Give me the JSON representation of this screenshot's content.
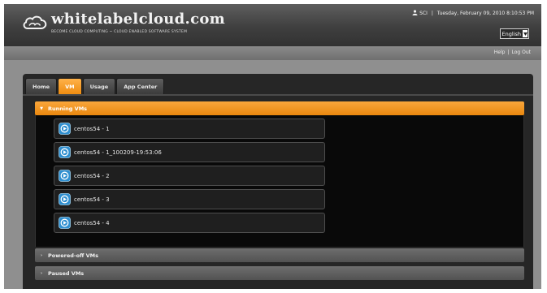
{
  "header": {
    "logo_text": "whitelabelcloud.com",
    "logo_tagline": "BECOME CLOUD COMPUTING ~ CLOUD ENABLED SOFTWARE SYSTEM",
    "username": "SCI",
    "separator": "|",
    "datetime": "Tuesday, February 09, 2010 8:10:53 PM",
    "language": "English"
  },
  "top_links": {
    "help": "Help",
    "logout": "Log Out",
    "separator": "|"
  },
  "tabs": [
    {
      "label": "Home",
      "active": false
    },
    {
      "label": "VM",
      "active": true
    },
    {
      "label": "Usage",
      "active": false
    },
    {
      "label": "App Center",
      "active": false
    }
  ],
  "sections": {
    "running": {
      "title": "Running VMs",
      "expanded": true,
      "caret": "▼"
    },
    "powered_off": {
      "title": "Powered-off VMs",
      "expanded": false,
      "caret": "›"
    },
    "paused": {
      "title": "Paused VMs",
      "expanded": false,
      "caret": "›"
    }
  },
  "running_vms": [
    {
      "name": "centos54 - 1"
    },
    {
      "name": "centos54 - 1_100209-19:53:06"
    },
    {
      "name": "centos54 - 2"
    },
    {
      "name": "centos54 - 3"
    },
    {
      "name": "centos54 - 4"
    }
  ],
  "colors": {
    "accent": "#f39a24",
    "vm_icon": "#2f8fd0"
  }
}
